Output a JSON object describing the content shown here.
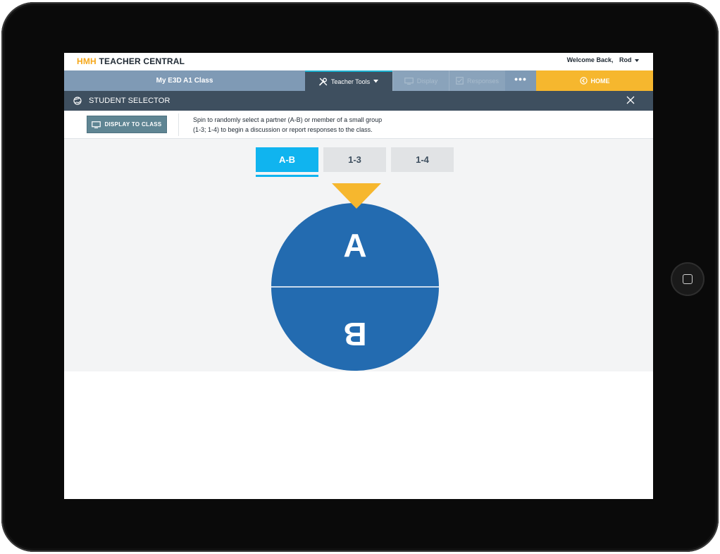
{
  "app": {
    "brand_prefix": "HMH",
    "brand_name": "TEACHER CENTRAL",
    "welcome_text": "Welcome Back,",
    "user_name": "Rod"
  },
  "nav": {
    "class_name": "My E3D A1 Class",
    "teacher_tools": "Teacher Tools",
    "display": "Display",
    "responses": "Responses",
    "more": "•••",
    "home": "HOME"
  },
  "panel": {
    "title": "STUDENT SELECTOR",
    "display_button": "DISPLAY TO CLASS",
    "instructions_line1": "Spin to randomly select a partner (A-B) or member of a small group",
    "instructions_line2": "(1-3; 1-4) to begin a discussion or report responses to the class."
  },
  "tabs": [
    {
      "label": "A-B",
      "selected": true
    },
    {
      "label": "1-3",
      "selected": false
    },
    {
      "label": "1-4",
      "selected": false
    }
  ],
  "spinner": {
    "segments": [
      "A",
      "B"
    ],
    "segment_color": "#236bb0",
    "pointer_color": "#f6b72e"
  },
  "colors": {
    "accent_blue": "#10b4ef",
    "home_yellow": "#f6b72e",
    "dark_slate": "#3e4f5f",
    "nav_blue": "#7f9ab5"
  }
}
